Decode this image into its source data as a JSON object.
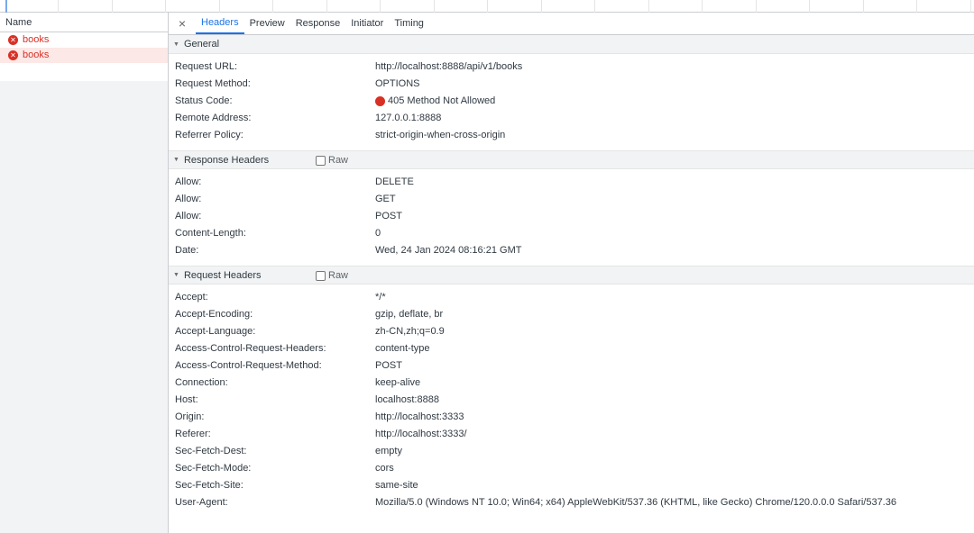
{
  "request_list": {
    "column_header": "Name",
    "items": [
      {
        "name": "books",
        "status": "error"
      },
      {
        "name": "books",
        "status": "error",
        "selected": true
      }
    ]
  },
  "detail_tabs": {
    "close_glyph": "×",
    "tabs": [
      "Headers",
      "Preview",
      "Response",
      "Initiator",
      "Timing"
    ],
    "active": "Headers"
  },
  "general": {
    "title": "General",
    "rows": [
      {
        "key": "Request URL:",
        "value": "http://localhost:8888/api/v1/books"
      },
      {
        "key": "Request Method:",
        "value": "OPTIONS"
      },
      {
        "key": "Status Code:",
        "value": "405 Method Not Allowed"
      },
      {
        "key": "Remote Address:",
        "value": "127.0.0.1:8888"
      },
      {
        "key": "Referrer Policy:",
        "value": "strict-origin-when-cross-origin"
      }
    ]
  },
  "response_headers": {
    "title": "Response Headers",
    "raw_label": "Raw",
    "rows": [
      {
        "key": "Allow:",
        "value": "DELETE"
      },
      {
        "key": "Allow:",
        "value": "GET"
      },
      {
        "key": "Allow:",
        "value": "POST"
      },
      {
        "key": "Content-Length:",
        "value": "0"
      },
      {
        "key": "Date:",
        "value": "Wed, 24 Jan 2024 08:16:21 GMT"
      }
    ]
  },
  "request_headers": {
    "title": "Request Headers",
    "raw_label": "Raw",
    "rows": [
      {
        "key": "Accept:",
        "value": "*/*"
      },
      {
        "key": "Accept-Encoding:",
        "value": "gzip, deflate, br"
      },
      {
        "key": "Accept-Language:",
        "value": "zh-CN,zh;q=0.9"
      },
      {
        "key": "Access-Control-Request-Headers:",
        "value": "content-type"
      },
      {
        "key": "Access-Control-Request-Method:",
        "value": "POST"
      },
      {
        "key": "Connection:",
        "value": "keep-alive"
      },
      {
        "key": "Host:",
        "value": "localhost:8888"
      },
      {
        "key": "Origin:",
        "value": "http://localhost:3333"
      },
      {
        "key": "Referer:",
        "value": "http://localhost:3333/"
      },
      {
        "key": "Sec-Fetch-Dest:",
        "value": "empty"
      },
      {
        "key": "Sec-Fetch-Mode:",
        "value": "cors"
      },
      {
        "key": "Sec-Fetch-Site:",
        "value": "same-site"
      },
      {
        "key": "User-Agent:",
        "value": "Mozilla/5.0 (Windows NT 10.0; Win64; x64) AppleWebKit/537.36 (KHTML, like Gecko) Chrome/120.0.0.0 Safari/537.36"
      }
    ]
  },
  "colors": {
    "error": "#d93025",
    "accent": "#1a73e8",
    "selected_row": "#fce8e6"
  }
}
